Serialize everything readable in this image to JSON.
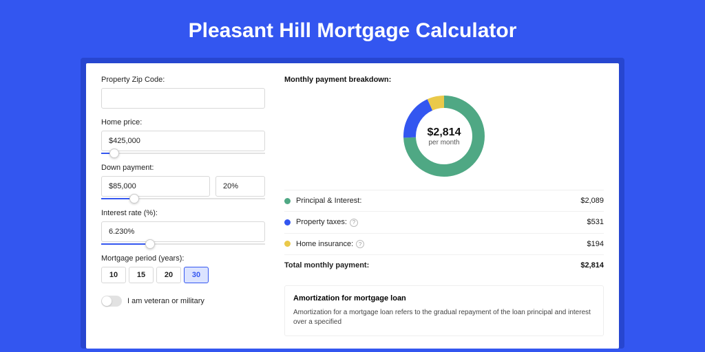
{
  "title": "Pleasant Hill Mortgage Calculator",
  "form": {
    "zip_label": "Property Zip Code:",
    "zip_value": "",
    "price_label": "Home price:",
    "price_value": "$425,000",
    "price_slider_pct": 8,
    "dp_label": "Down payment:",
    "dp_amount": "$85,000",
    "dp_percent": "20%",
    "dp_slider_pct": 20,
    "rate_label": "Interest rate (%):",
    "rate_value": "6.230%",
    "rate_slider_pct": 30,
    "period_label": "Mortgage period (years):",
    "periods": [
      "10",
      "15",
      "20",
      "30"
    ],
    "period_active": "30",
    "veteran_label": "I am veteran or military"
  },
  "breakdown": {
    "title": "Monthly payment breakdown:",
    "total": "$2,814",
    "per_month": "per month",
    "items": [
      {
        "label": "Principal & Interest:",
        "value": "$2,089",
        "color": "#4fa884",
        "help": false
      },
      {
        "label": "Property taxes:",
        "value": "$531",
        "color": "#3356f0",
        "help": true
      },
      {
        "label": "Home insurance:",
        "value": "$194",
        "color": "#eac94a",
        "help": true
      }
    ],
    "total_label": "Total monthly payment:",
    "total_value": "$2,814"
  },
  "chart_data": {
    "type": "pie",
    "title": "Monthly payment breakdown",
    "series": [
      {
        "name": "Principal & Interest",
        "value": 2089,
        "color": "#4fa884"
      },
      {
        "name": "Property taxes",
        "value": 531,
        "color": "#3356f0"
      },
      {
        "name": "Home insurance",
        "value": 194,
        "color": "#eac94a"
      }
    ],
    "total": 2814,
    "center_label": "$2,814",
    "center_sub": "per month"
  },
  "amort": {
    "title": "Amortization for mortgage loan",
    "text": "Amortization for a mortgage loan refers to the gradual repayment of the loan principal and interest over a specified"
  }
}
